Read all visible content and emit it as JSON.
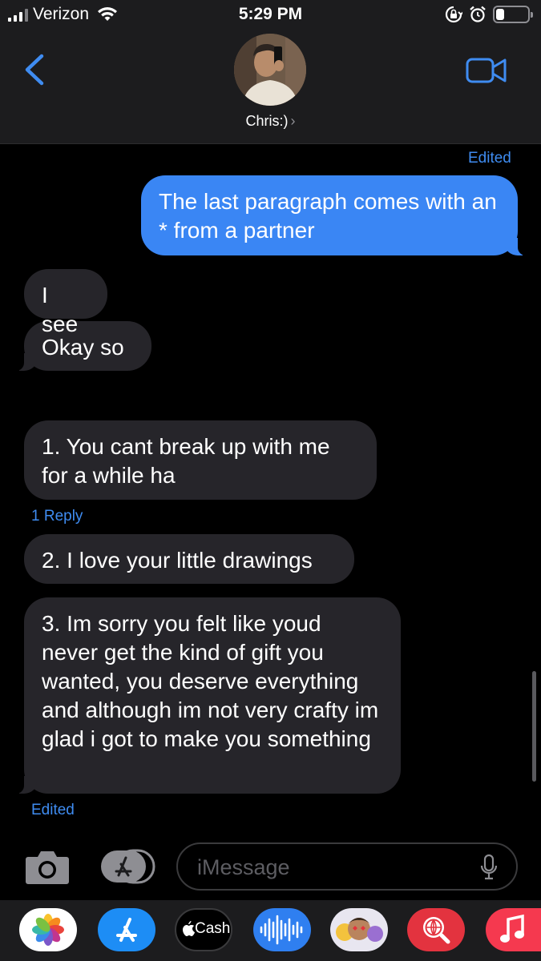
{
  "status_bar": {
    "carrier": "Verizon",
    "time": "5:29 PM",
    "battery_level": 0.25
  },
  "header": {
    "contact_name": "Chris:)",
    "chevron": "›",
    "back_icon": "chevron-left-icon",
    "video_icon": "video-camera-icon"
  },
  "messages": {
    "edited_top": "Edited",
    "m1": "The last paragraph comes with an * from a partner",
    "m2": "I see",
    "m3": "Okay so",
    "m4": "1. You cant break up with me for a while ha",
    "reply_count": "1 Reply",
    "m5": "2. I love your little drawings",
    "m6": "3. Im sorry you felt like youd never get the kind of gift you wanted, you deserve everything and although im not very crafty im glad i got to make you something",
    "edited_bottom": "Edited"
  },
  "compose": {
    "placeholder": "iMessage"
  },
  "app_drawer": {
    "apps": [
      "Photos",
      "App Store",
      "Cash",
      "Audio Messages",
      "Memoji",
      "Web Search",
      "Music"
    ],
    "cash_label": "Cash"
  },
  "colors": {
    "outgoing_bubble": "#3a86f4",
    "incoming_bubble": "#26252a",
    "accent": "#3f8cf1",
    "header_bg": "#1c1c1e"
  }
}
